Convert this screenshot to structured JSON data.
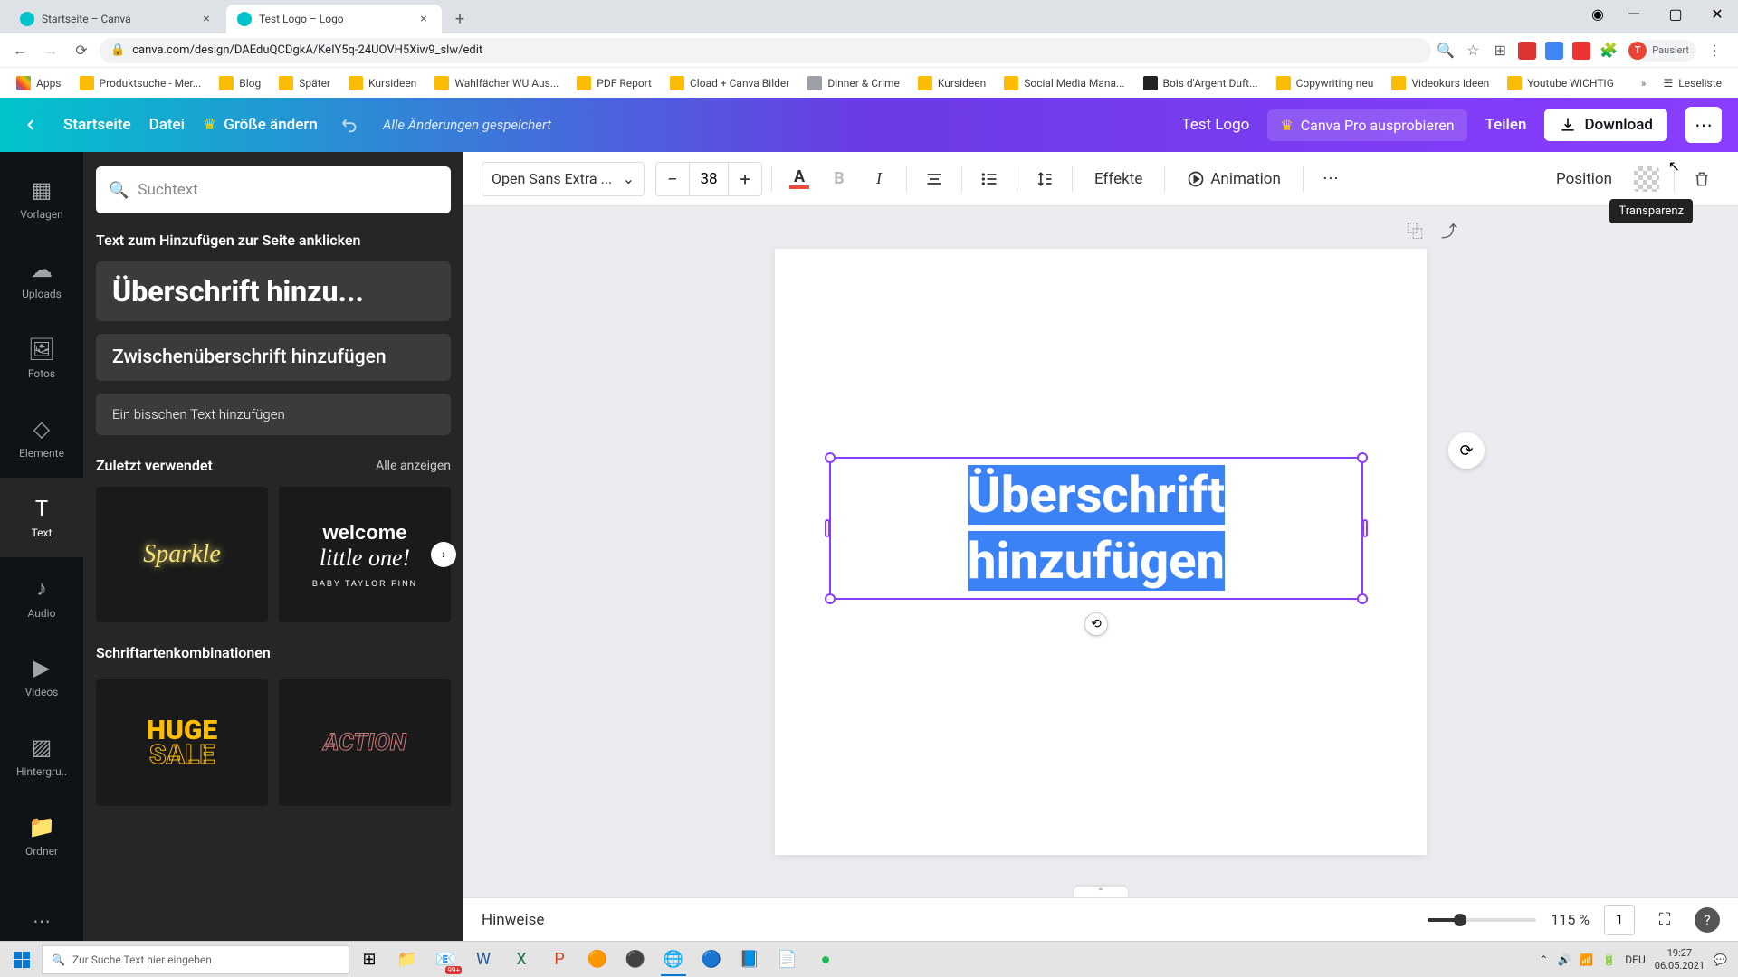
{
  "browser": {
    "tabs": [
      {
        "title": "Startseite – Canva"
      },
      {
        "title": "Test Logo – Logo"
      }
    ],
    "url": "canva.com/design/DAEduQCDgkA/KeIY5q-24UOVH5Xiw9_slw/edit",
    "profile_status": "Pausiert",
    "profile_letter": "T",
    "reading_list": "Leseliste",
    "bookmarks": [
      "Apps",
      "Produktsuche - Mer...",
      "Blog",
      "Später",
      "Kursideen",
      "Wahlfächer WU Aus...",
      "PDF Report",
      "Cload + Canva Bilder",
      "Dinner & Crime",
      "Kursideen",
      "Social Media Mana...",
      "Bois d'Argent Duft...",
      "Copywriting neu",
      "Videokurs Ideen",
      "Youtube WICHTIG"
    ]
  },
  "header": {
    "home": "Startseite",
    "file": "Datei",
    "resize": "Größe ändern",
    "saved": "Alle Änderungen gespeichert",
    "doc_title": "Test Logo",
    "pro_cta": "Canva Pro ausprobieren",
    "share": "Teilen",
    "download": "Download"
  },
  "rail": {
    "templates": "Vorlagen",
    "uploads": "Uploads",
    "photos": "Fotos",
    "elements": "Elemente",
    "text": "Text",
    "audio": "Audio",
    "videos": "Videos",
    "background": "Hintergru..",
    "folders": "Ordner"
  },
  "panel": {
    "search_placeholder": "Suchtext",
    "click_hint": "Text zum Hinzufügen zur Seite anklicken",
    "add_heading": "Überschrift hinzu...",
    "add_subheading": "Zwischenüberschrift hinzufügen",
    "add_body": "Ein bisschen Text hinzufügen",
    "recent_title": "Zuletzt verwendet",
    "see_all": "Alle anzeigen",
    "thumb_sparkle": "Sparkle",
    "thumb_welcome_1": "welcome",
    "thumb_welcome_2": "little one!",
    "thumb_welcome_3": "BABY TAYLOR FINN",
    "combos_title": "Schriftartenkombinationen",
    "combo_huge": "HUGE",
    "combo_sale": "SALE",
    "combo_action": "ACTION"
  },
  "toolbar": {
    "font_name": "Open Sans Extra ...",
    "font_size": "38",
    "effects": "Effekte",
    "animation": "Animation",
    "position": "Position",
    "tooltip_transparency": "Transparenz"
  },
  "canvas": {
    "text_content": "Überschrift hinzufügen"
  },
  "footer": {
    "notes": "Hinweise",
    "zoom": "115 %",
    "page_indicator": "1"
  },
  "taskbar": {
    "search_placeholder": "Zur Suche Text hier eingeben",
    "lang": "DEU",
    "time": "19:27",
    "date": "06.05.2021",
    "mail_badge": "99+"
  }
}
